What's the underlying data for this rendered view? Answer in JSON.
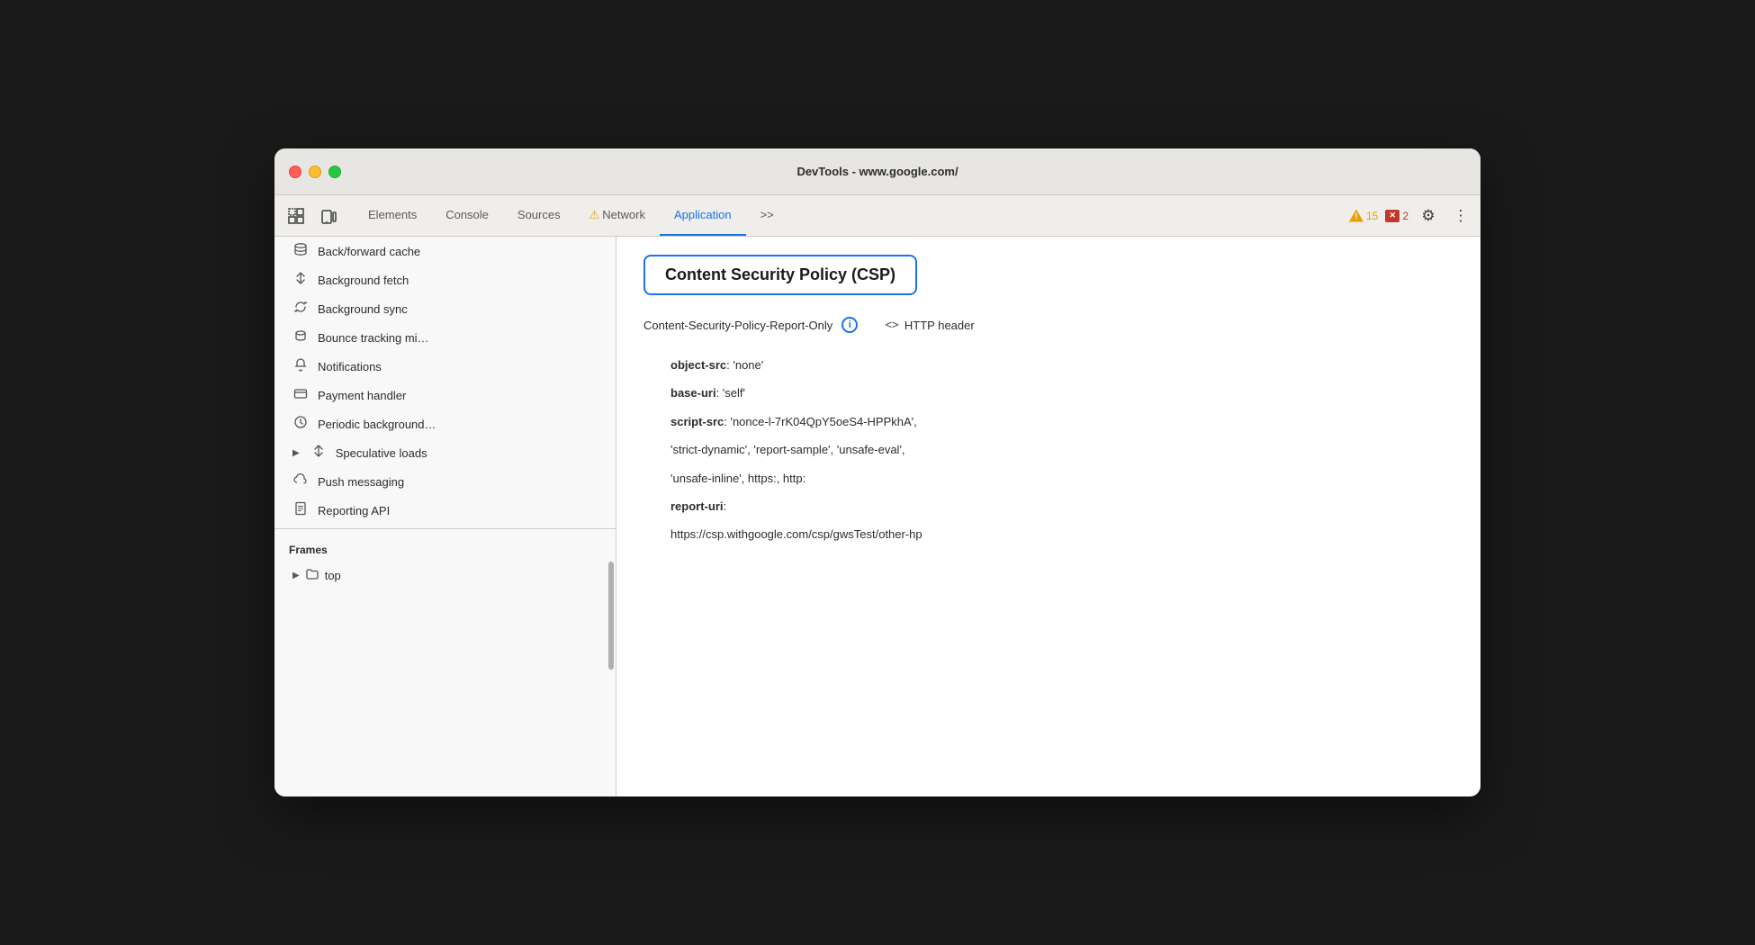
{
  "window": {
    "title": "DevTools - www.google.com/"
  },
  "toolbar": {
    "tabs": [
      {
        "id": "elements",
        "label": "Elements",
        "active": false,
        "has_warning": false
      },
      {
        "id": "console",
        "label": "Console",
        "active": false,
        "has_warning": false
      },
      {
        "id": "sources",
        "label": "Sources",
        "active": false,
        "has_warning": false
      },
      {
        "id": "network",
        "label": "Network",
        "active": false,
        "has_warning": true
      },
      {
        "id": "application",
        "label": "Application",
        "active": true,
        "has_warning": false
      }
    ],
    "more_label": ">>",
    "warn_count": "15",
    "error_count": "2"
  },
  "sidebar": {
    "items": [
      {
        "id": "back-forward-cache",
        "icon": "🗄",
        "label": "Back/forward cache"
      },
      {
        "id": "background-fetch",
        "icon": "↕",
        "label": "Background fetch"
      },
      {
        "id": "background-sync",
        "icon": "↻",
        "label": "Background sync"
      },
      {
        "id": "bounce-tracking",
        "icon": "🗄",
        "label": "Bounce tracking mi…"
      },
      {
        "id": "notifications",
        "icon": "🔔",
        "label": "Notifications"
      },
      {
        "id": "payment-handler",
        "icon": "💳",
        "label": "Payment handler"
      },
      {
        "id": "periodic-background",
        "icon": "🕐",
        "label": "Periodic background…"
      },
      {
        "id": "speculative-loads",
        "icon": "↕",
        "label": "Speculative loads",
        "has_arrow": true
      },
      {
        "id": "push-messaging",
        "icon": "☁",
        "label": "Push messaging"
      },
      {
        "id": "reporting-api",
        "icon": "📄",
        "label": "Reporting API"
      }
    ],
    "frames_section": "Frames",
    "frames_item": "top"
  },
  "content": {
    "csp_title": "Content Security Policy (CSP)",
    "policy_label": "Content-Security-Policy-Report-Only",
    "http_header_text": "HTTP header",
    "directives": [
      {
        "key": "object-src",
        "value": ": 'none'"
      },
      {
        "key": "base-uri",
        "value": ": 'self'"
      },
      {
        "key": "script-src",
        "value": ": 'nonce-l-7rK04QpY5oeS4-HPPkhA',"
      },
      {
        "key": "",
        "value": "'strict-dynamic', 'report-sample', 'unsafe-eval',"
      },
      {
        "key": "",
        "value": "'unsafe-inline', https:, http:"
      },
      {
        "key": "report-uri",
        "value": ":"
      },
      {
        "key": "",
        "value": "https://csp.withgoogle.com/csp/gwsTest/other-hp"
      }
    ]
  }
}
